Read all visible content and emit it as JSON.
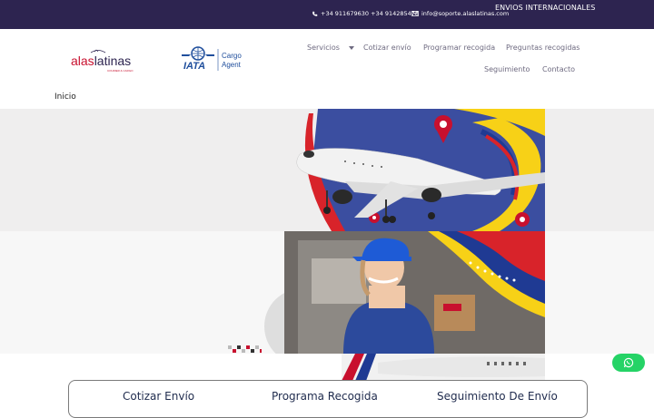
{
  "topbar": {
    "phones": "+34 911679630 +34 914285478",
    "email": "info@soporte.alaslatinas.com",
    "international": "ENVIOS INTERNACIONALES"
  },
  "brand": {
    "logo_text": "alaslatinas",
    "logo_tagline": "COURIER & CARGO",
    "logo_sup": "envío seguro",
    "iata_text": "IATA",
    "iata_cargo": "Cargo",
    "iata_agent": "Agent"
  },
  "nav": {
    "servicios": "Servicios",
    "cotizar": "Cotizar envío",
    "programar": "Programar recogida",
    "preguntas": "Preguntas recogidas",
    "seguimiento": "Seguimiento",
    "contacto": "Contacto",
    "inicio": "Inicio"
  },
  "tabs": {
    "cotizar": "Cotizar Envío",
    "programa": "Programa Recogida",
    "seguimiento": "Seguimiento De Envío"
  },
  "colors": {
    "topbar": "#2d2450",
    "accent_red": "#c8102e",
    "navy": "#1f2b4d",
    "whatsapp": "#25d366"
  },
  "icons": {
    "phone": "phone-icon",
    "email": "envelope-icon",
    "dropdown": "chevron-down-icon",
    "whatsapp": "whatsapp-icon"
  }
}
